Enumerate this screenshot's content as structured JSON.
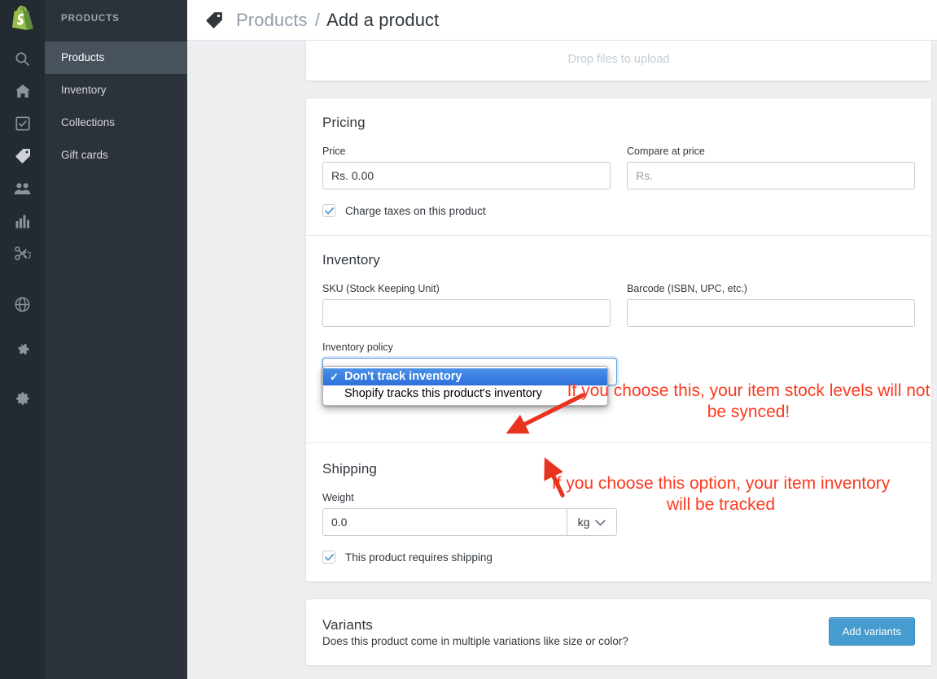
{
  "app": {
    "brand": "shopify-logo",
    "accent_blue": "#479ccf",
    "annotation_red": "#fc3a20",
    "select_highlight_blue": "#2d71d9"
  },
  "rail": {
    "icons": [
      {
        "name": "search-icon",
        "label": "Search"
      },
      {
        "name": "home-icon",
        "label": "Home"
      },
      {
        "name": "orders-icon",
        "label": "Orders"
      },
      {
        "name": "products-icon",
        "label": "Products"
      },
      {
        "name": "customers-icon",
        "label": "Customers"
      },
      {
        "name": "analytics-icon",
        "label": "Analytics"
      },
      {
        "name": "discounts-icon",
        "label": "Discounts"
      },
      {
        "name": "online-store-icon",
        "label": "Online Store"
      },
      {
        "name": "apps-icon",
        "label": "Apps"
      },
      {
        "name": "settings-icon",
        "label": "Settings"
      }
    ]
  },
  "sidebar": {
    "title": "PRODUCTS",
    "items": [
      {
        "label": "Products",
        "active": true
      },
      {
        "label": "Inventory",
        "active": false
      },
      {
        "label": "Collections",
        "active": false
      },
      {
        "label": "Gift cards",
        "active": false
      }
    ]
  },
  "topbar": {
    "icon": "tag-icon",
    "breadcrumb_parent": "Products",
    "breadcrumb_separator": "/",
    "breadcrumb_current": "Add a product"
  },
  "media": {
    "icon": "photos-stack-icon",
    "drop_text": "Drop files to upload"
  },
  "pricing": {
    "title": "Pricing",
    "price_label": "Price",
    "price_value": "Rs. 0.00",
    "compare_label": "Compare at price",
    "compare_placeholder": "Rs.",
    "compare_value": "",
    "charge_taxes_label": "Charge taxes on this product",
    "charge_taxes_checked": true
  },
  "inventory": {
    "title": "Inventory",
    "sku_label": "SKU (Stock Keeping Unit)",
    "sku_value": "",
    "barcode_label": "Barcode (ISBN, UPC, etc.)",
    "barcode_value": "",
    "policy_label": "Inventory policy",
    "policy_options": [
      {
        "label": "Don't track inventory",
        "selected": true
      },
      {
        "label": "Shopify tracks this product's inventory",
        "selected": false
      }
    ],
    "policy_checkmark": "✓"
  },
  "shipping": {
    "title": "Shipping",
    "weight_label": "Weight",
    "weight_value": "0.0",
    "weight_unit": "kg",
    "unit_caret": "chevron-down-icon",
    "requires_shipping_label": "This product requires shipping",
    "requires_shipping_checked": true
  },
  "variants": {
    "title": "Variants",
    "subtitle": "Does this product come in multiple variations like size or color?",
    "button_label": "Add variants"
  },
  "annotations": [
    {
      "id": "anno-1",
      "text": "If you choose this, your item stock levels will not be synced!",
      "points_to": "policy-option-dont-track"
    },
    {
      "id": "anno-2",
      "text": "If you choose this option, your item inventory will be tracked",
      "points_to": "policy-option-shopify-tracks"
    }
  ]
}
